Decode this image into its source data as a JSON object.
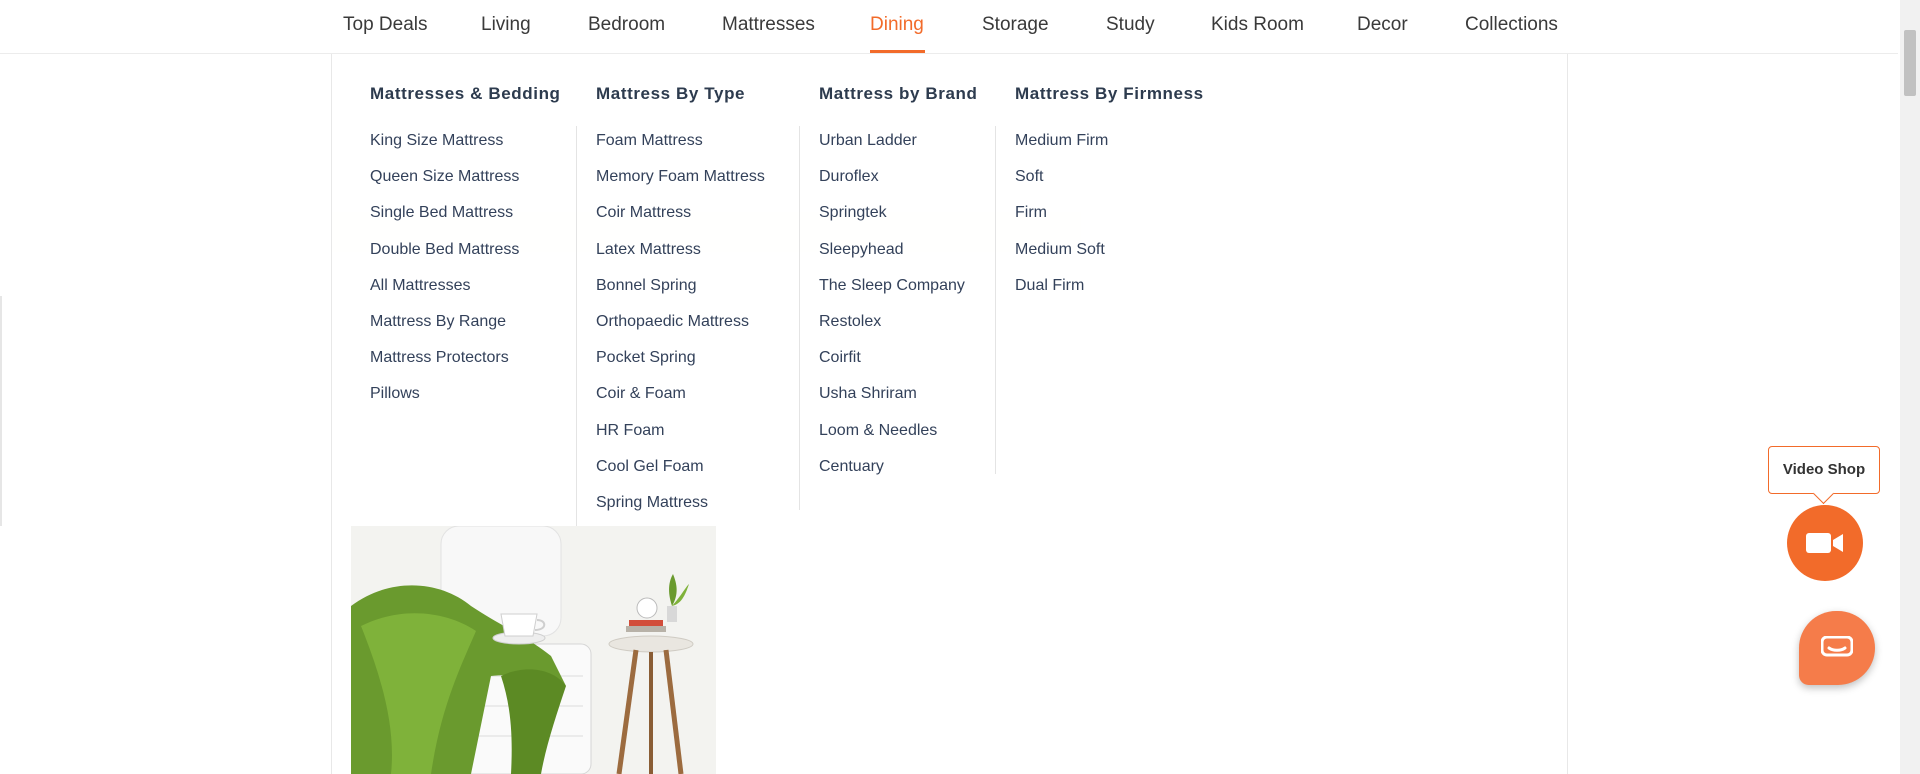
{
  "nav": {
    "items": [
      {
        "label": "Top Deals",
        "active": false
      },
      {
        "label": "Living",
        "active": false
      },
      {
        "label": "Bedroom",
        "active": false
      },
      {
        "label": "Mattresses",
        "active": false
      },
      {
        "label": "Dining",
        "active": true
      },
      {
        "label": "Storage",
        "active": false
      },
      {
        "label": "Study",
        "active": false
      },
      {
        "label": "Kids Room",
        "active": false
      },
      {
        "label": "Decor",
        "active": false
      },
      {
        "label": "Collections",
        "active": false
      }
    ]
  },
  "mega_menu": {
    "columns": [
      {
        "title": "Mattresses & Bedding",
        "items": [
          "King Size Mattress",
          "Queen Size Mattress",
          "Single Bed Mattress",
          "Double Bed Mattress",
          "All Mattresses",
          "Mattress By Range",
          "Mattress Protectors",
          "Pillows"
        ]
      },
      {
        "title": "Mattress By Type",
        "items": [
          "Foam Mattress",
          "Memory Foam Mattress",
          "Coir Mattress",
          "Latex Mattress",
          "Bonnel Spring",
          "Orthopaedic Mattress",
          "Pocket Spring",
          "Coir & Foam",
          "HR Foam",
          "Cool Gel Foam",
          "Spring Mattress"
        ]
      },
      {
        "title": "Mattress by Brand",
        "items": [
          "Urban Ladder",
          "Duroflex",
          "Springtek",
          "Sleepyhead",
          "The Sleep Company",
          "Restolex",
          "Coirfit",
          "Usha Shriram",
          "Loom & Needles",
          "Centuary"
        ]
      },
      {
        "title": "Mattress By Firmness",
        "items": [
          "Medium Firm",
          "Soft",
          "Firm",
          "Medium Soft",
          "Dual Firm"
        ]
      }
    ]
  },
  "widgets": {
    "video_shop_label": "Video Shop",
    "video_icon": "video-camera-icon",
    "chat_icon": "chat-bubble-icon"
  },
  "colors": {
    "accent": "#f26b2a",
    "text": "#2d3b4e"
  }
}
